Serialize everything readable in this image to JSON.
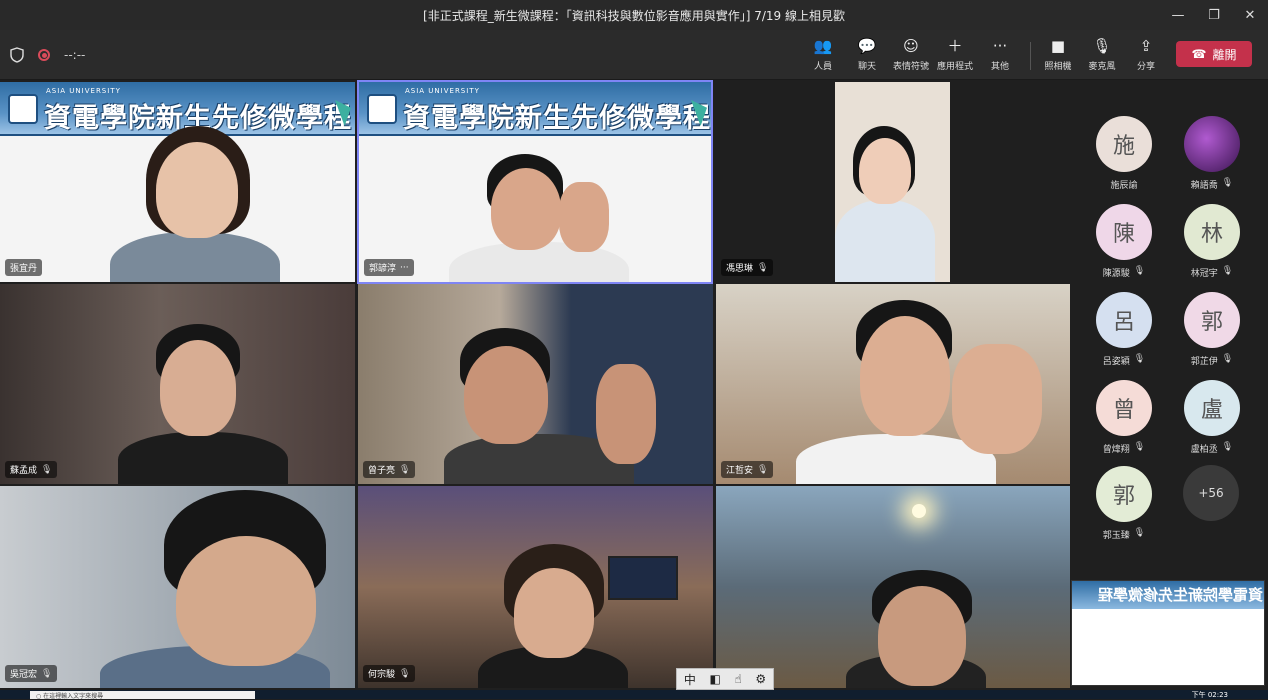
{
  "window": {
    "title": "[非正式課程_新生微課程：「資訊科技與數位影音應用與實作」] 7/19 線上相見歡",
    "minimize": "—",
    "maximize": "❐",
    "close": "✕"
  },
  "toolbar": {
    "timer": "--:--",
    "people": "人員",
    "chat": "聊天",
    "reactions": "表情符號",
    "apps": "應用程式",
    "more": "其他",
    "camera": "照相機",
    "mic": "麥克風",
    "share": "分享",
    "leave": "離開"
  },
  "banner": {
    "org": "ASIA UNIVERSITY",
    "title": "資電學院新生先修微學程"
  },
  "tiles": [
    {
      "name": "張宜丹",
      "muted": false
    },
    {
      "name": "郭諺淳",
      "muted": false,
      "extra": "···"
    },
    {
      "name": "馮思琳",
      "muted": true
    },
    {
      "name": "蘇孟成",
      "muted": true
    },
    {
      "name": "曾子亮",
      "muted": true
    },
    {
      "name": "江哲安",
      "muted": true
    },
    {
      "name": "吳冠宏",
      "muted": true
    },
    {
      "name": "何宗駿",
      "muted": true
    },
    {
      "name": "",
      "muted": true
    }
  ],
  "roster": [
    {
      "initial": "施",
      "name": "施辰諭",
      "muted": false,
      "color": "#eadfd9"
    },
    {
      "initial": "",
      "name": "賴語喬",
      "muted": true,
      "color": "#6b2f8a"
    },
    {
      "initial": "陳",
      "name": "陳源駿",
      "muted": true,
      "color": "#efd7e8"
    },
    {
      "initial": "林",
      "name": "林冠宇",
      "muted": true,
      "color": "#e1e9d2"
    },
    {
      "initial": "呂",
      "name": "呂姿穎",
      "muted": true,
      "color": "#d5e0f0"
    },
    {
      "initial": "郭",
      "name": "郭芷伊",
      "muted": true,
      "color": "#f0d9e7"
    },
    {
      "initial": "曾",
      "name": "曾煒翔",
      "muted": true,
      "color": "#f5dcd7"
    },
    {
      "initial": "盧",
      "name": "盧柏丞",
      "muted": true,
      "color": "#d8e8ee"
    },
    {
      "initial": "郭",
      "name": "郭玉臻",
      "muted": true,
      "color": "#e3ecd6"
    }
  ],
  "roster_more": "+56",
  "ime": {
    "mode": "中",
    "icon1": "◧",
    "icon2": "☝",
    "icon3": "⚙"
  },
  "taskbar": {
    "search": "○ 在這裡輸入文字來搜尋",
    "clock": "下午 02:23"
  }
}
